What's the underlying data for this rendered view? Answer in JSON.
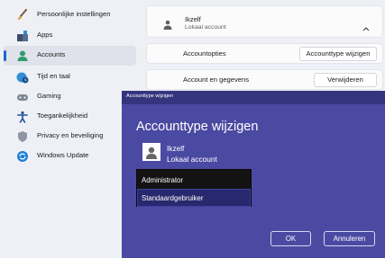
{
  "sidebar": {
    "items": [
      {
        "label": "Persoonlijke instellingen",
        "icon": "brush-icon"
      },
      {
        "label": "Apps",
        "icon": "apps-icon"
      },
      {
        "label": "Accounts",
        "icon": "person-icon",
        "active": true
      },
      {
        "label": "Tijd en taal",
        "icon": "globe-clock-icon"
      },
      {
        "label": "Gaming",
        "icon": "gamepad-icon"
      },
      {
        "label": "Toegankelijkheid",
        "icon": "accessibility-icon"
      },
      {
        "label": "Privacy en beveiliging",
        "icon": "shield-icon"
      },
      {
        "label": "Windows Update",
        "icon": "update-icon"
      }
    ]
  },
  "account": {
    "name": "Ikzelf",
    "type": "Lokaal account",
    "rows": [
      {
        "label": "Accountopties",
        "button": "Accounttype wijzigen"
      },
      {
        "label": "Account en gegevens",
        "button": "Verwijderen"
      }
    ]
  },
  "dialog": {
    "title": "Accounttype wijzigen",
    "heading": "Accounttype wijzigen",
    "user_name": "Ikzelf",
    "user_type": "Lokaal account",
    "options": [
      "Administrator",
      "Standaardgebruiker"
    ],
    "selected": "Standaardgebruiker",
    "ok_label": "OK",
    "cancel_label": "Annuleren"
  },
  "colors": {
    "accent": "#1769c9",
    "dialog_bg": "#4b4aa2",
    "dialog_titlebar": "#35357f",
    "listbox_bg": "#131313",
    "listbox_selected": "#28286e"
  }
}
